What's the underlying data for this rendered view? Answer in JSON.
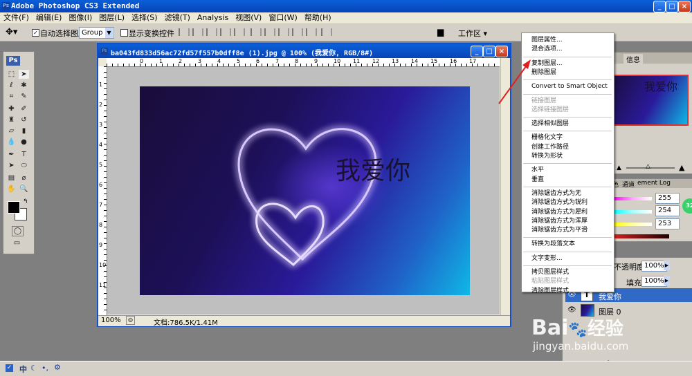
{
  "window": {
    "title": "Adobe Photoshop CS3 Extended",
    "min": "_",
    "max": "□",
    "close": "×"
  },
  "menubar": [
    "文件(F)",
    "编辑(E)",
    "图像(I)",
    "图层(L)",
    "选择(S)",
    "滤镜(T)",
    "Analysis",
    "视图(V)",
    "窗口(W)",
    "帮助(H)"
  ],
  "options": {
    "auto_select_label": "自动选择图层",
    "auto_select_checked": true,
    "group_value": "Group",
    "show_transform_label": "显示变换控件",
    "workspace_label": "工作区 ▾"
  },
  "document": {
    "title": "ba043fd833d56ac72fd57f557b0dff8e (1).jpg @ 100% (我爱你, RGB/8#)",
    "canvas_text": "我爱你",
    "zoom": "100%",
    "doc_size": "文档:786.5K/1.41M",
    "ruler_h": [
      "0",
      "1",
      "2",
      "3",
      "4",
      "5",
      "6",
      "7",
      "8",
      "9",
      "10",
      "11",
      "12",
      "13",
      "14",
      "15",
      "16",
      "17"
    ],
    "ruler_v": [
      "1",
      "2",
      "3",
      "4",
      "5",
      "6",
      "7",
      "8",
      "9",
      "10",
      "11"
    ]
  },
  "navigator": {
    "tab_info": "信息",
    "thumb_text": "我爱你"
  },
  "color": {
    "tabs": [
      "色",
      "通道",
      "ement Log"
    ],
    "r": "255",
    "g": "254",
    "b": "253"
  },
  "layers": {
    "opacity_label": "不透明度:",
    "opacity": "100%",
    "fill_label": "填充:",
    "fill": "100%",
    "items": [
      {
        "name": "我爱你",
        "kind": "T",
        "selected": true
      },
      {
        "name": "图层 0",
        "kind": "img",
        "selected": false
      }
    ],
    "badge": "32"
  },
  "context_menu": [
    {
      "label": "图层属性...",
      "disabled": false
    },
    {
      "label": "混合选项...",
      "disabled": false
    },
    {
      "sep": true
    },
    {
      "label": "复制图层...",
      "disabled": false
    },
    {
      "label": "删除图层",
      "disabled": false
    },
    {
      "sep": true
    },
    {
      "label": "Convert to Smart Object",
      "disabled": false
    },
    {
      "sep": true
    },
    {
      "label": "链接图层",
      "disabled": true
    },
    {
      "label": "选择链接图层",
      "disabled": true
    },
    {
      "sep": true
    },
    {
      "label": "选择相似图层",
      "disabled": false
    },
    {
      "sep": true
    },
    {
      "label": "栅格化文字",
      "disabled": false
    },
    {
      "label": "创建工作路径",
      "disabled": false
    },
    {
      "label": "转换为形状",
      "disabled": false
    },
    {
      "sep": true
    },
    {
      "label": "水平",
      "disabled": false
    },
    {
      "label": "垂直",
      "disabled": false
    },
    {
      "sep": true
    },
    {
      "label": "消除锯齿方式为无",
      "disabled": false
    },
    {
      "label": "消除锯齿方式为锐利",
      "disabled": false
    },
    {
      "label": "消除锯齿方式为犀利",
      "disabled": false
    },
    {
      "label": "消除锯齿方式为浑厚",
      "disabled": false
    },
    {
      "label": "消除锯齿方式为平滑",
      "disabled": false
    },
    {
      "sep": true
    },
    {
      "label": "转换为段落文本",
      "disabled": false
    },
    {
      "sep": true
    },
    {
      "label": "文字变形...",
      "disabled": false
    },
    {
      "sep": true
    },
    {
      "label": "拷贝图层样式",
      "disabled": false
    },
    {
      "label": "粘贴图层样式",
      "disabled": true
    },
    {
      "label": "清除图层样式",
      "disabled": false
    }
  ],
  "taskbar": {
    "ime": "中"
  },
  "watermark": {
    "brand": "Bai",
    "brand2": "经验",
    "url": "jingyan.baidu.com"
  }
}
